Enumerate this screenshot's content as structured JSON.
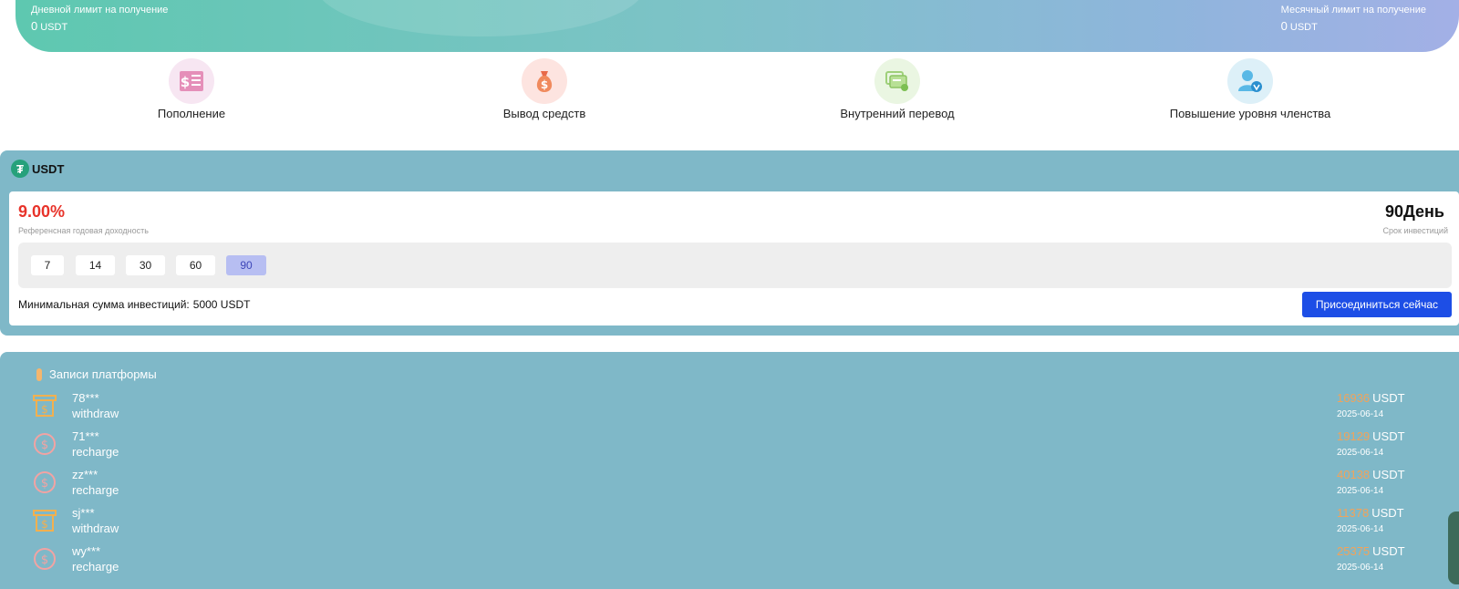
{
  "limits": {
    "daily_label": "Дневной лимит на получение",
    "daily_value": "0",
    "daily_unit": "USDT",
    "monthly_label": "Месячный лимит на получение",
    "monthly_value": "0",
    "monthly_unit": "USDT"
  },
  "actions": {
    "deposit": "Пополнение",
    "withdraw": "Вывод средств",
    "transfer": "Внутренний перевод",
    "upgrade": "Повышение уровня членства"
  },
  "product": {
    "coin": "USDT",
    "rate": "9.00%",
    "rate_label": "Референсная годовая доходность",
    "term": "90День",
    "term_label": "Срок инвестиций",
    "day_options": [
      "7",
      "14",
      "30",
      "60",
      "90"
    ],
    "selected_day": "90",
    "min_label": "Минимальная сумма инвестиций:",
    "min_value": "5000 USDT",
    "join_label": "Присоединиться сейчас"
  },
  "records": {
    "title": "Записи платформы",
    "items": [
      {
        "user": "78***",
        "type": "withdraw",
        "amount": "16936",
        "unit": "USDT",
        "date": "2025-06-14"
      },
      {
        "user": "71***",
        "type": "recharge",
        "amount": "19129",
        "unit": "USDT",
        "date": "2025-06-14"
      },
      {
        "user": "zz***",
        "type": "recharge",
        "amount": "40138",
        "unit": "USDT",
        "date": "2025-06-14"
      },
      {
        "user": "sj***",
        "type": "withdraw",
        "amount": "11378",
        "unit": "USDT",
        "date": "2025-06-14"
      },
      {
        "user": "wy***",
        "type": "recharge",
        "amount": "25375",
        "unit": "USDT",
        "date": "2025-06-14"
      }
    ]
  },
  "icons": {
    "deposit": "deposit-invoice-icon",
    "withdraw": "money-bag-icon",
    "transfer": "transfer-icon",
    "upgrade": "member-verified-icon",
    "withdraw_record": "withdraw-box-icon",
    "recharge_record": "dollar-circle-icon"
  },
  "colors": {
    "accent": "#1d4ee6",
    "rate": "#e8332a",
    "amount": "#f2a35a",
    "panel": "#7fb8c8",
    "coin": "#26a17b"
  }
}
